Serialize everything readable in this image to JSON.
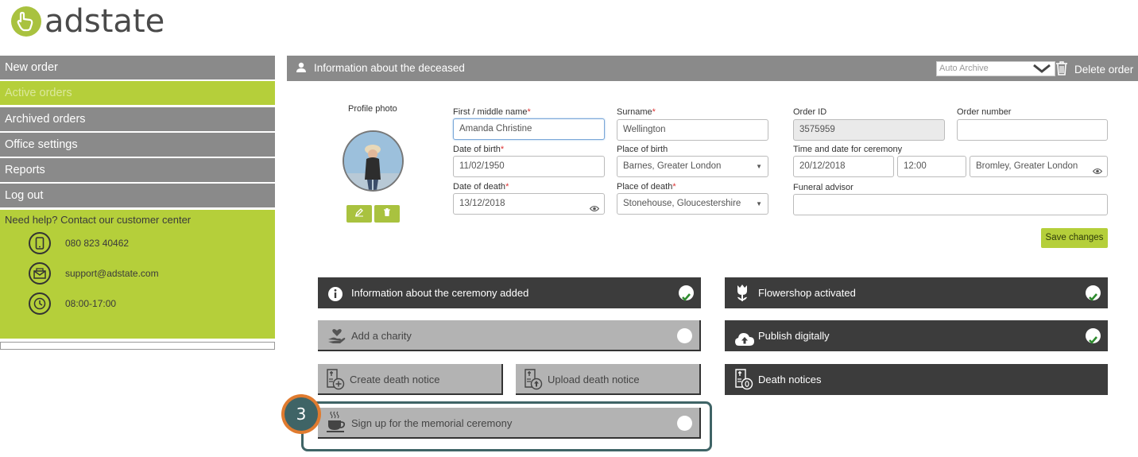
{
  "brand": {
    "name": "adstate",
    "accent": "#b5cf3a"
  },
  "sidebar": {
    "items": [
      {
        "label": "New order",
        "active": false
      },
      {
        "label": "Active orders",
        "active": true
      },
      {
        "label": "Archived orders",
        "active": false
      },
      {
        "label": "Office settings",
        "active": false
      },
      {
        "label": "Reports",
        "active": false
      },
      {
        "label": "Log out",
        "active": false
      }
    ],
    "help": {
      "title": "Need help? Contact our customer center",
      "phone": "080 823 40462",
      "email": "support@adstate.com",
      "hours": "08:00-17:00"
    }
  },
  "header": {
    "title": "Information about the deceased",
    "archive_select": "Auto Archive",
    "delete_label": "Delete order"
  },
  "profile": {
    "label": "Profile photo"
  },
  "form": {
    "first_name": {
      "label": "First / middle name",
      "value": "Amanda Christine"
    },
    "surname": {
      "label": "Surname",
      "value": "Wellington"
    },
    "order_id": {
      "label": "Order ID",
      "value": "3575959"
    },
    "order_number": {
      "label": "Order number",
      "value": ""
    },
    "date_of_birth": {
      "label": "Date of birth",
      "value": "11/02/1950"
    },
    "place_of_birth": {
      "label": "Place of birth",
      "value": "Barnes, Greater London"
    },
    "ceremony": {
      "label": "Time and date for ceremony",
      "date": "20/12/2018",
      "time": "12:00",
      "place": "Bromley, Greater London"
    },
    "date_of_death": {
      "label": "Date of death",
      "value": "13/12/2018"
    },
    "place_of_death": {
      "label": "Place of death",
      "value": "Stonehouse, Gloucestershire"
    },
    "funeral_advisor": {
      "label": "Funeral advisor",
      "value": ""
    },
    "required_mark": "*",
    "save_label": "Save changes"
  },
  "actions": {
    "ceremony_info": "Information about the ceremony added",
    "flowershop": "Flowershop activated",
    "charity": "Add a charity",
    "publish": "Publish digitally",
    "create_notice": "Create death notice",
    "upload_notice": "Upload death notice",
    "death_notices": "Death notices",
    "memorial": "Sign up for the memorial ceremony"
  },
  "annotation": {
    "step": "3"
  }
}
